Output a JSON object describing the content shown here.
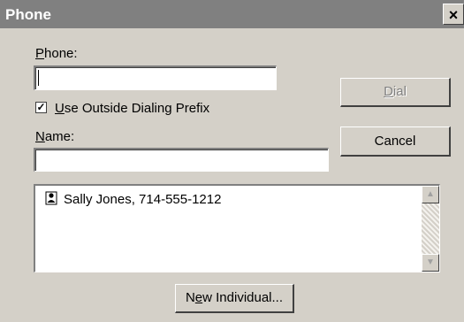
{
  "window": {
    "title": "Phone",
    "close_glyph": "×"
  },
  "phone_label": {
    "accel": "P",
    "rest": "hone:"
  },
  "phone_input": {
    "value": ""
  },
  "checkbox": {
    "checked": true,
    "mark": "✓",
    "accel": "U",
    "rest": "se Outside Dialing Prefix"
  },
  "name_label": {
    "accel": "N",
    "rest": "ame:"
  },
  "name_input": {
    "value": ""
  },
  "buttons": {
    "dial": {
      "accel": "D",
      "rest": "ial"
    },
    "cancel": "Cancel",
    "new_individual": {
      "pre": "N",
      "accel": "e",
      "rest": "w Individual..."
    }
  },
  "list": {
    "items": [
      {
        "icon": "person-icon",
        "label": "Sally Jones, 714-555-1212"
      }
    ],
    "scroll_up": "▲",
    "scroll_down": "▼"
  }
}
